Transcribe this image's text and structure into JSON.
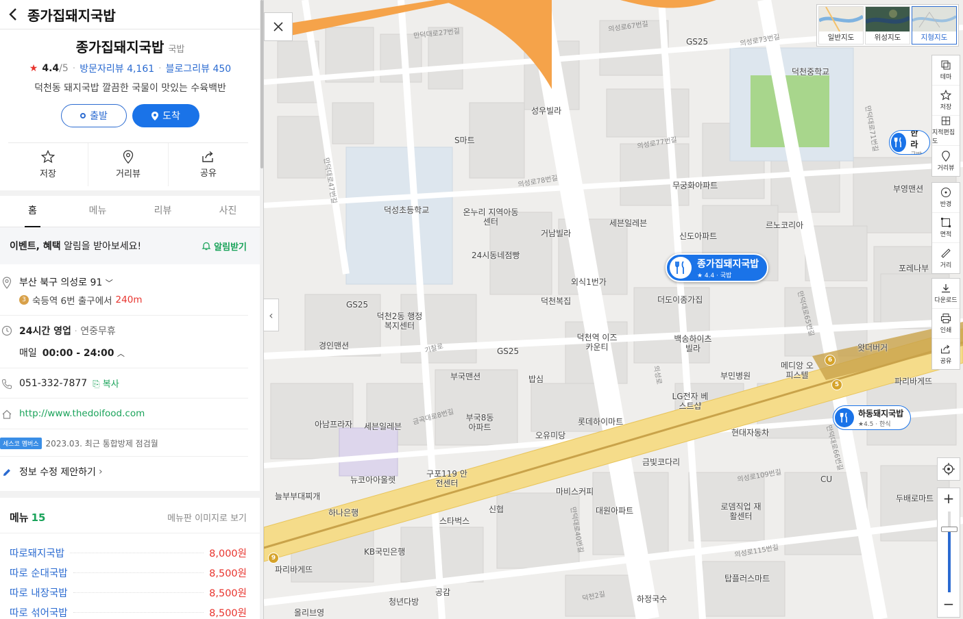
{
  "header": {
    "title": "종가집돼지국밥"
  },
  "place": {
    "name": "종가집돼지국밥",
    "category": "국밥",
    "rating": "4.4",
    "rating_max": "/5",
    "visitor_reviews_label": "방문자리뷰",
    "visitor_reviews_count": "4,161",
    "blog_reviews_label": "블로그리뷰",
    "blog_reviews_count": "450",
    "description": "덕천동 돼지국밥 깔끔한 국물이 맛있는 수육백반"
  },
  "route": {
    "start_label": "출발",
    "arrive_label": "도착"
  },
  "actions": [
    {
      "label": "저장",
      "icon": "star-icon"
    },
    {
      "label": "거리뷰",
      "icon": "pin-icon"
    },
    {
      "label": "공유",
      "icon": "share-icon"
    }
  ],
  "tabs": [
    {
      "label": "홈"
    },
    {
      "label": "메뉴"
    },
    {
      "label": "리뷰"
    },
    {
      "label": "사진"
    }
  ],
  "notice": {
    "text_bold": "이벤트, 혜택",
    "text": " 알림을 받아보세요!",
    "button": "알림받기"
  },
  "info": {
    "address": "부산 북구 의성로 91",
    "station_line": "3",
    "station": "숙등역 6번 출구에서",
    "station_distance": "240m",
    "hours_status": "24시간 영업",
    "hours_note": "연중무휴",
    "daily_label": "매일",
    "daily_hours": "00:00 - 24:00",
    "phone": "051-332-7877",
    "copy_label": "복사",
    "website": "http://www.thedoifood.com",
    "seco_tag": "세스코 멤버스",
    "seco_text": "2023.03. 최근 통합방제 점검월",
    "suggest": "정보 수정 제안하기"
  },
  "menu": {
    "title": "메뉴",
    "count": "15",
    "image_link": "메뉴판 이미지로 보기",
    "items": [
      {
        "name": "따로돼지국밥",
        "price": "8,000원"
      },
      {
        "name": "따로 순대국밥",
        "price": "8,500원"
      },
      {
        "name": "따로 내장국밥",
        "price": "8,500원"
      },
      {
        "name": "따로 섞어국밥",
        "price": "8,500원"
      }
    ]
  },
  "map": {
    "map_types": [
      {
        "label": "일반지도",
        "selected": false
      },
      {
        "label": "위성지도",
        "selected": false
      },
      {
        "label": "지형지도",
        "selected": true
      }
    ],
    "tools_top": [
      {
        "label": "테마",
        "icon": "theme-icon"
      },
      {
        "label": "저장",
        "icon": "star-icon"
      },
      {
        "label": "지적편집도",
        "icon": "cadastral-icon"
      },
      {
        "label": "거리뷰",
        "icon": "streetview-icon"
      }
    ],
    "tools_mid": [
      {
        "label": "반경",
        "icon": "radius-icon"
      },
      {
        "label": "면적",
        "icon": "area-icon"
      },
      {
        "label": "거리",
        "icon": "ruler-icon"
      }
    ],
    "tools_bottom": [
      {
        "label": "다운로드",
        "icon": "download-icon"
      },
      {
        "label": "인쇄",
        "icon": "print-icon"
      },
      {
        "label": "공유",
        "icon": "share-icon"
      }
    ],
    "zoom_level": 0.78,
    "main_marker": {
      "name": "종가집돼지국밥",
      "sub": "★ 4.4 · 국밥"
    },
    "sub_markers": [
      {
        "name": "하동돼지국밥",
        "sub": "★4.5 · 한식"
      },
      {
        "name": "한라",
        "sub": "국밥"
      }
    ],
    "labels": [
      "GS25",
      "덕천중학교",
      "성우빌라",
      "S마트",
      "무궁화아파트",
      "르노코리아",
      "덕성초등학교",
      "온누리 지역아동센터",
      "거남빌라",
      "세븐일레븐",
      "신도아파트",
      "24시동네점빵",
      "외식1번가",
      "더도이종가집",
      "덕천복집",
      "GS25",
      "덕천2동 행정복지센터",
      "GS25",
      "경인맨션",
      "덕천역 이즈카운티",
      "백송하이츠 빌라",
      "부국맨션",
      "밥심",
      "부민병원",
      "메디앙 오피스텔",
      "왓더버거",
      "파리바게뜨",
      "LG전자 베스트샵",
      "아남프라자",
      "세븐일레븐",
      "부국8동 아파트",
      "오유미당",
      "롯데하이마트",
      "현대자동차",
      "금빛코다리",
      "뉴코아아울렛",
      "구포119 안전센터",
      "마비스커피",
      "늘부부대찌개",
      "하나은행",
      "스타벅스",
      "신협",
      "대원아파트",
      "로뎀직업 재활센터",
      "CU",
      "두배로마트",
      "KB국민은행",
      "파리바게뜨",
      "공감",
      "청년다방",
      "올리브영",
      "하정국수",
      "탑플러스마트",
      "부영맨션",
      "포레나부"
    ],
    "roads": [
      "만덕대로27번길",
      "의성로67번길",
      "의성로73번길",
      "의성로77번길",
      "의성로78번길",
      "만덕대로47번길",
      "기찰로",
      "금곡대로8번길",
      "의성로",
      "만덕대로65번길",
      "의성로109번길",
      "만덕대로40번길",
      "의성로115번길",
      "덕천2길",
      "만덕대로66번길",
      "만덕대로71번길"
    ],
    "metro_lines": [
      "6",
      "5",
      "9"
    ]
  }
}
